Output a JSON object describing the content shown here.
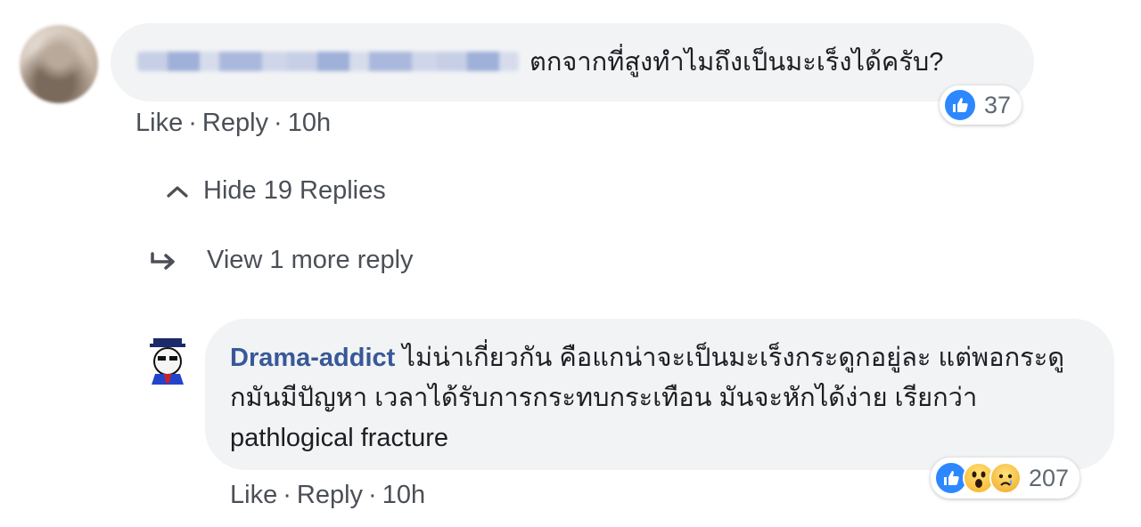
{
  "comment": {
    "question": "ตกจากที่สูงทำไมถึงเป็นมะเร็งได้ครับ?",
    "reaction_count": "37",
    "actions": {
      "like": "Like",
      "reply": "Reply",
      "time": "10h",
      "sep": "·"
    }
  },
  "replies_toggle": {
    "label": "Hide 19 Replies",
    "icon": "chevron-up-icon"
  },
  "more_replies": {
    "label": "View 1 more reply",
    "icon": "reply-arrow-icon"
  },
  "reply": {
    "author": "Drama-addict",
    "text": " ไม่น่าเกี่ยวกัน คือแกน่าจะเป็นมะเร็งกระดูกอยู่ละ แต่พอกระดูกมันมีปัญหา เวลาได้รับการกระทบกระเทือน มันจะหักได้ง่าย เรียกว่า pathlogical fracture",
    "reaction_count": "207",
    "reactions": [
      "like-icon",
      "wow-icon",
      "sad-icon"
    ],
    "actions": {
      "like": "Like",
      "reply": "Reply",
      "time": "10h",
      "sep": "·"
    }
  },
  "colors": {
    "bubble": "#f2f3f5",
    "link": "#385898",
    "like_blue": "#2d88ff",
    "meta_text": "#4b4f56"
  }
}
